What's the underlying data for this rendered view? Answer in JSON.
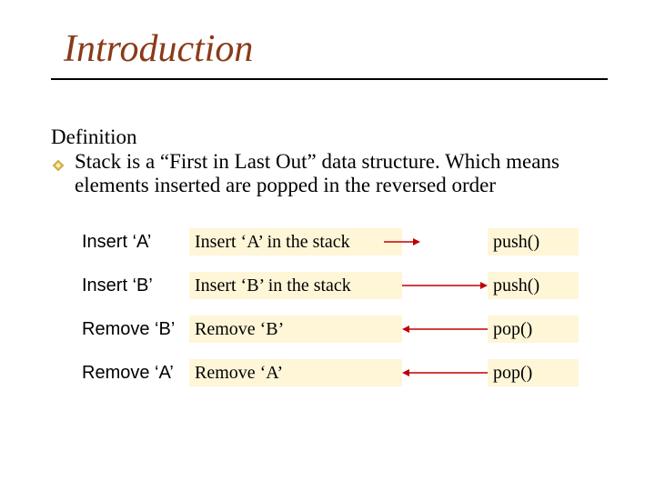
{
  "title": "Introduction",
  "definition_label": "Definition",
  "definition_text": "Stack is a “First in Last Out” data structure. Which means elements inserted are popped in the reversed order",
  "rows": [
    {
      "action": "Insert ‘A’",
      "desc": "Insert  ‘A’ in the stack",
      "dir": "right",
      "short": true,
      "func": "push()"
    },
    {
      "action": "Insert ‘B’",
      "desc": "Insert  ‘B’ in the stack",
      "dir": "right",
      "short": false,
      "func": "push()"
    },
    {
      "action": "Remove ‘B’",
      "desc": "Remove  ‘B’",
      "dir": "left",
      "short": false,
      "func": "pop()"
    },
    {
      "action": "Remove ‘A’",
      "desc": "Remove  ‘A’",
      "dir": "left",
      "short": false,
      "func": "pop()"
    }
  ],
  "colors": {
    "title": "#8b3a1a",
    "highlight": "#fff6d8",
    "arrow": "#c00000"
  }
}
